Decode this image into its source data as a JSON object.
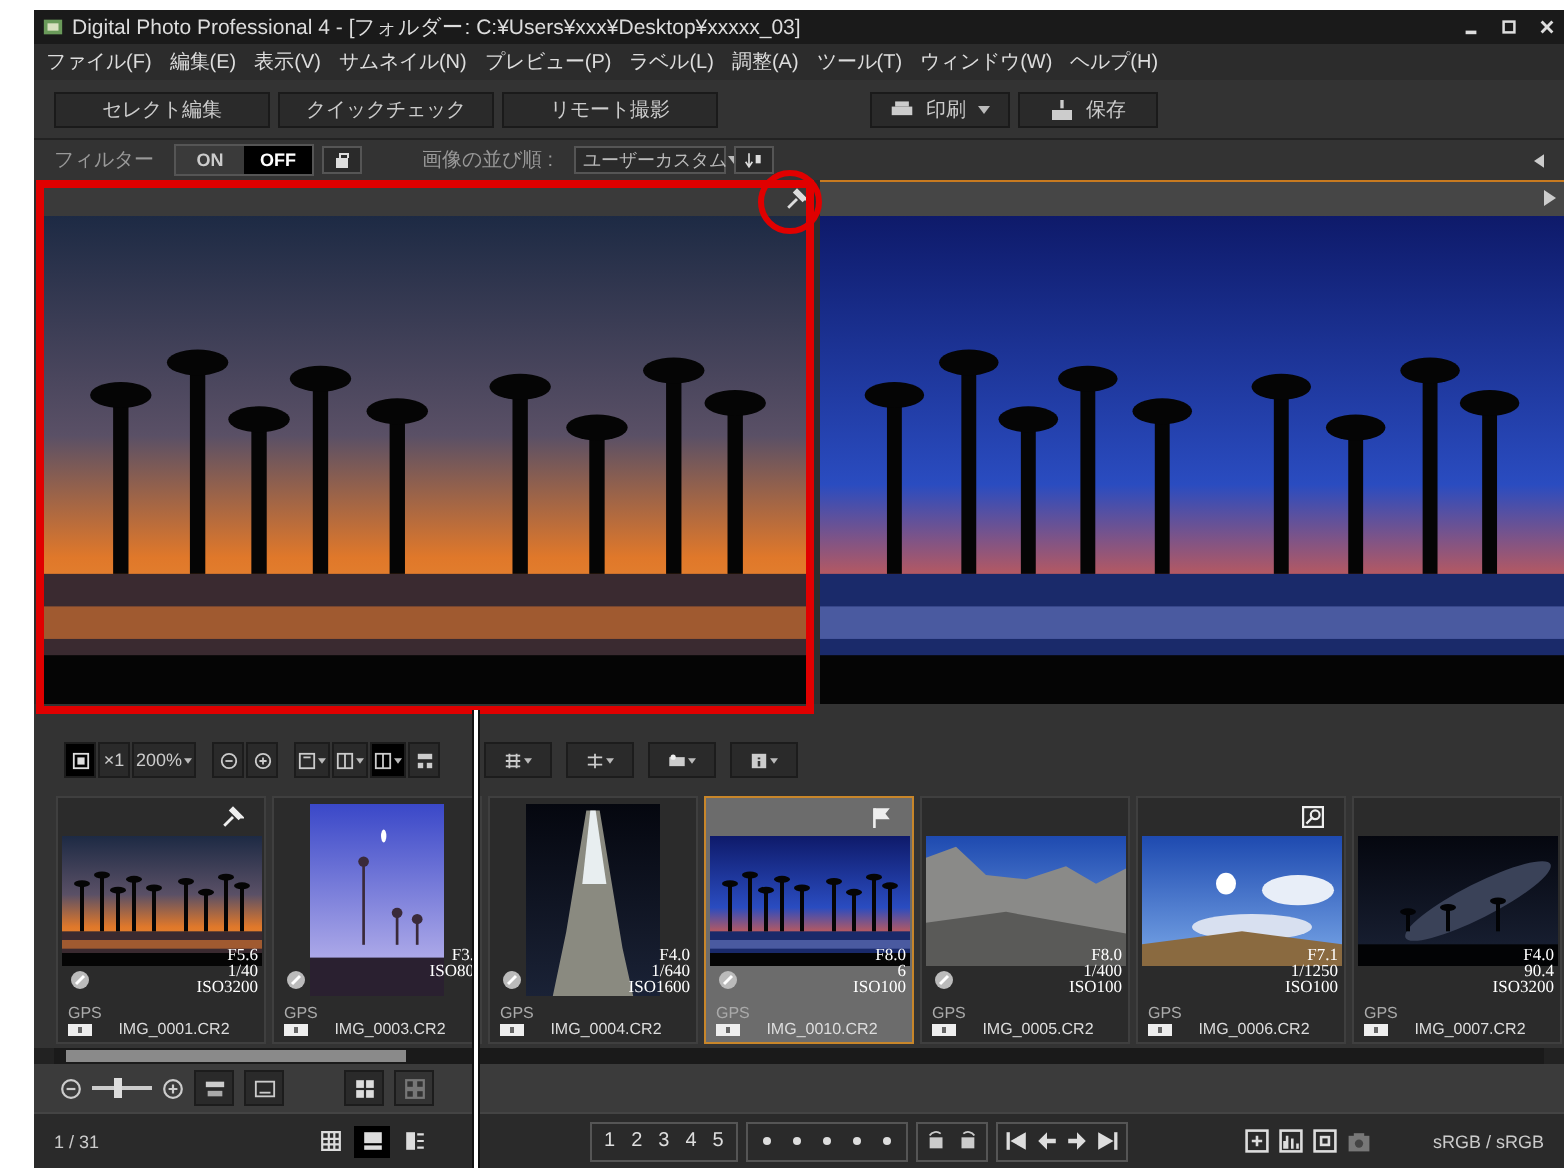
{
  "window": {
    "title": "Digital Photo Professional 4 - [フォルダー: C:¥Users¥xxx¥Desktop¥xxxxx_03]"
  },
  "menu": [
    {
      "label": "ファイル(F)"
    },
    {
      "label": "編集(E)"
    },
    {
      "label": "表示(V)"
    },
    {
      "label": "サムネイル(N)"
    },
    {
      "label": "プレビュー(P)"
    },
    {
      "label": "ラベル(L)"
    },
    {
      "label": "調整(A)"
    },
    {
      "label": "ツール(T)"
    },
    {
      "label": "ウィンドウ(W)"
    },
    {
      "label": "ヘルプ(H)"
    }
  ],
  "toolbar": {
    "buttons": [
      {
        "label": "セレクト編集"
      },
      {
        "label": "クイックチェック"
      },
      {
        "label": "リモート撮影"
      }
    ],
    "print": {
      "label": "印刷"
    },
    "save": {
      "label": "保存"
    }
  },
  "filter_bar": {
    "label": "フィルター",
    "toggle": [
      {
        "label": "ON",
        "selected": false
      },
      {
        "label": "OFF",
        "selected": true
      }
    ],
    "sort_label": "画像の並び順 :",
    "sort_value": "ユーザーカスタム"
  },
  "preview": {
    "panes": [
      {
        "pinned": true,
        "selected": false
      },
      {
        "pinned": false,
        "selected": true
      }
    ]
  },
  "view_toolbar": {
    "scale": "×1",
    "zoom": "200%"
  },
  "thumbnails": [
    {
      "name": "IMG_0001.CR2",
      "aperture": "F5.6",
      "shutter": "1/40",
      "iso": "ISO3200",
      "badge": {
        "kind": "pin"
      },
      "edited": true,
      "gps": "GPS",
      "selected": false
    },
    {
      "name": "IMG_0003.CR2",
      "aperture": "F3.",
      "iso": "ISO80",
      "edited": true,
      "gps": "GPS",
      "selected": false
    },
    {
      "name": "IMG_0004.CR2",
      "aperture": "F4.0",
      "shutter": "1/640",
      "iso": "ISO1600",
      "edited": true,
      "gps": "GPS",
      "selected": false
    },
    {
      "name": "IMG_0010.CR2",
      "aperture": "F8.0",
      "shutter": "6",
      "iso": "ISO100",
      "badge": {
        "kind": "flag"
      },
      "edited": true,
      "gps": "GPS",
      "selected": true
    },
    {
      "name": "IMG_0005.CR2",
      "aperture": "F8.0",
      "shutter": "1/400",
      "iso": "ISO100",
      "edited": true,
      "gps": "GPS",
      "selected": false
    },
    {
      "name": "IMG_0006.CR2",
      "aperture": "F7.1",
      "shutter": "1/1250",
      "iso": "ISO100",
      "badge": {
        "kind": "zoom"
      },
      "edited": false,
      "gps": "GPS",
      "selected": false
    },
    {
      "name": "IMG_0007.CR2",
      "aperture": "F4.0",
      "shutter": "90.4",
      "iso": "ISO3200",
      "edited": false,
      "gps": "GPS",
      "selected": false
    }
  ],
  "thumb_size": {
    "level": 0.42
  },
  "status_bar": {
    "count": "1 / 31",
    "view_modes": [
      {
        "selected": false
      },
      {
        "selected": true
      },
      {
        "selected": false
      }
    ],
    "ratings": [
      "1",
      "2",
      "3",
      "4",
      "5"
    ],
    "color_space": "sRGB / sRGB"
  }
}
